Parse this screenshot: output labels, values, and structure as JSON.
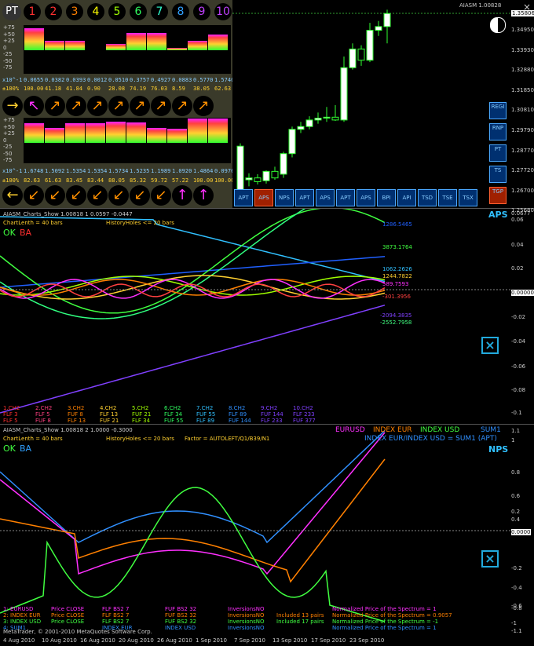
{
  "toolbar": {
    "pt_label": "PT",
    "numbers": [
      "1",
      "2",
      "3",
      "4",
      "5",
      "6",
      "7",
      "8",
      "9",
      "10"
    ],
    "number_colors": [
      "#ff3030",
      "#ff3030",
      "#ff8000",
      "#ffff00",
      "#a0ff00",
      "#30ff60",
      "#30ffd0",
      "#30a0ff",
      "#c040ff",
      "#c040ff"
    ]
  },
  "panel1": {
    "scale": [
      "+75",
      "+50",
      "+25",
      "0",
      "-25",
      "-50",
      "-75"
    ],
    "row_x10": [
      "x10^-1",
      "0.0655",
      "0.0382",
      "0.0393",
      "0.0012",
      "0.0510",
      "0.3757",
      "0.4927",
      "0.0883",
      "0.5770",
      "1.5740"
    ],
    "row_pct": [
      "±100%",
      "100.00",
      "41.18",
      "41.84",
      "0.90",
      "28.08",
      "74.19",
      "76.03",
      "8.59",
      "38.05",
      "62.63"
    ],
    "arrows": [
      "→",
      "↖",
      "↗",
      "↗",
      "↗",
      "↗",
      "↗",
      "↗",
      "↗",
      "↗"
    ]
  },
  "panel2": {
    "scale": [
      "+75",
      "+50",
      "+25",
      "0",
      "-25",
      "-50",
      "-75"
    ],
    "row_x10": [
      "x10^-1",
      "1.6748",
      "1.5092",
      "1.5354",
      "1.5354",
      "1.5734",
      "1.5235",
      "1.1989",
      "1.0920",
      "1.4864",
      "0.0976"
    ],
    "row_pct": [
      "±100%",
      "82.63",
      "61.63",
      "83.45",
      "83.44",
      "88.05",
      "85.32",
      "59.72",
      "57.22",
      "100.00",
      "100.00"
    ],
    "arrows": [
      "←",
      "↙",
      "↙",
      "↙",
      "↙",
      "↙",
      "↙",
      "↙",
      "↑",
      "↑"
    ]
  },
  "price_chart": {
    "title": "AIASM 1.00828",
    "current_price": "1.35806",
    "price_labels": [
      "1.34950",
      "1.33930",
      "1.32880",
      "1.31850",
      "1.30810",
      "1.29790",
      "1.28770",
      "1.27720",
      "1.26700",
      "1.25680"
    ],
    "side_buttons": [
      "REGI",
      "RNP",
      "PT",
      "TS",
      "TGP"
    ],
    "bottom_buttons": [
      "APT",
      "APS",
      "NPS",
      "APT",
      "APS",
      "APT",
      "APS",
      "BPI",
      "API",
      "TSD",
      "TSE",
      "TSX"
    ],
    "candles": [
      {
        "o": 1.258,
        "h": 1.2885,
        "l": 1.2565,
        "c": 1.287
      },
      {
        "o": 1.269,
        "h": 1.2725,
        "l": 1.2655,
        "c": 1.27
      },
      {
        "o": 1.27,
        "h": 1.272,
        "l": 1.2665,
        "c": 1.268
      },
      {
        "o": 1.2685,
        "h": 1.274,
        "l": 1.267,
        "c": 1.2735
      },
      {
        "o": 1.2735,
        "h": 1.276,
        "l": 1.269,
        "c": 1.27
      },
      {
        "o": 1.272,
        "h": 1.284,
        "l": 1.27,
        "c": 1.283
      },
      {
        "o": 1.283,
        "h": 1.2975,
        "l": 1.281,
        "c": 1.296
      },
      {
        "o": 1.296,
        "h": 1.3,
        "l": 1.294,
        "c": 1.2975
      },
      {
        "o": 1.2975,
        "h": 1.303,
        "l": 1.296,
        "c": 1.301
      },
      {
        "o": 1.301,
        "h": 1.305,
        "l": 1.299,
        "c": 1.302
      },
      {
        "o": 1.302,
        "h": 1.308,
        "l": 1.3,
        "c": 1.3025
      },
      {
        "o": 1.3025,
        "h": 1.309,
        "l": 1.3005,
        "c": 1.301
      },
      {
        "o": 1.301,
        "h": 1.335,
        "l": 1.3,
        "c": 1.329
      },
      {
        "o": 1.329,
        "h": 1.342,
        "l": 1.328,
        "c": 1.339
      },
      {
        "o": 1.339,
        "h": 1.341,
        "l": 1.33,
        "c": 1.333
      },
      {
        "o": 1.333,
        "h": 1.353,
        "l": 1.332,
        "c": 1.349
      },
      {
        "o": 1.349,
        "h": 1.354,
        "l": 1.346,
        "c": 1.351
      },
      {
        "o": 1.351,
        "h": 1.36,
        "l": 1.342,
        "c": 1.358
      }
    ]
  },
  "indicator1": {
    "title": "AIASM_Charts_Show 1.00818 1 0.0597 -0.0447",
    "chart_length": "ChartLenth = 40 bars",
    "history_holes": "HistoryHoles <= 20 bars",
    "tag": "APS",
    "ok": "OK",
    "ba": "BA",
    "axis": [
      "0.0677",
      "0.06",
      "0.04",
      "0.02",
      "0.00000",
      "-0.02",
      "-0.04",
      "-0.06",
      "-0.08",
      "-0.1"
    ],
    "value_labels": [
      {
        "text": "1286.5465",
        "color": "#2060ff"
      },
      {
        "text": "3873.1764",
        "color": "#40ff40"
      },
      {
        "text": "1062.2626",
        "color": "#30c0ff"
      },
      {
        "text": "1244.7822",
        "color": "#ffd030"
      },
      {
        "text": "589.7593",
        "color": "#ff30ff"
      },
      {
        "text": "-301.3956",
        "color": "#ff4040"
      },
      {
        "text": "-2094.3835",
        "color": "#8040ff"
      },
      {
        "text": "-2552.7958",
        "color": "#40ff80"
      }
    ],
    "legend_cols": [
      [
        "1.CH2",
        "FLF  3",
        "FLF  5"
      ],
      [
        "2.CH2",
        "FLF  5",
        "FUF  8"
      ],
      [
        "3.CH2",
        "FUF  8",
        "FLF 13"
      ],
      [
        "4.CH2",
        "FLF 13",
        "FUF 21"
      ],
      [
        "5.CH2",
        "FUF 21",
        "FLF 34"
      ],
      [
        "6.CH2",
        "FLF 34",
        "FUF 55"
      ],
      [
        "7.CH2",
        "FUF 55",
        "FLF 89"
      ],
      [
        "8.CH2",
        "FLF 89",
        "FUF 144"
      ],
      [
        "9.CH2",
        "FUF 144",
        "FLF 233"
      ],
      [
        "10.CH2",
        "FLF 233",
        "FUF 377"
      ]
    ]
  },
  "indicator2": {
    "title": "AIASM_Charts_Show 1.00818 2 1.0000 -0.3000",
    "chart_length": "ChartLenth = 40 bars",
    "history_holes": "HistoryHoles <= 20 bars",
    "factor": "Factor = AUTOLEFT/Q1/B39/N1",
    "tag": "NPS",
    "ok": "OK",
    "ba": "BA",
    "header_a": "EURUSD",
    "header_b": "INDEX EUR",
    "header_c": "INDEX USD",
    "header_d": "SUM1",
    "header_e": "INDEX EUR/INDEX USD = SUM1 (APT)",
    "axis": [
      "1.1",
      "1",
      "0.8",
      "0.6",
      "0.4",
      "0.2",
      "0.0000",
      "-0.2",
      "-0.4",
      "-0.6",
      "-0.8",
      "-1",
      "-1.1"
    ],
    "legend_rows": [
      {
        "a": "1: EURUSD",
        "b": "Price CLOSE",
        "c": "FLF BS2 7",
        "d": "FUF BS2 32",
        "e": "InversionsNO",
        "f": "",
        "g": "Normalized Price of the Spectrum = 1",
        "color": "#ff30ff"
      },
      {
        "a": "2: INDEX EUR",
        "b": "Price CLOSE",
        "c": "FLF BS2 7",
        "d": "FUF BS2 32",
        "e": "InversionsNO",
        "f": "Included 13 pairs",
        "g": "Normalized Price of the Spectrum = 0.9057",
        "color": "#ff8000"
      },
      {
        "a": "3: INDEX USD",
        "b": "Price CLOSE",
        "c": "FLF BS2 7",
        "d": "FUF BS2 32",
        "e": "InversionsNO",
        "f": "Included 17 pairs",
        "g": "Normalized Price of the Spectrum = -1",
        "color": "#40ff40"
      },
      {
        "a": "4: SUM1",
        "b": "",
        "c": "INDEX EUR",
        "d": "INDEX USD",
        "e": "InversionsNO",
        "f": "",
        "g": "Normalized Price of the Spectrum = 1",
        "color": "#3090ff"
      }
    ],
    "copyright": "MetaTrader, © 2001-2010 MetaQuotes Software Corp."
  },
  "dates": [
    "4 Aug 2010",
    "10 Aug 2010",
    "16 Aug 2010",
    "20 Aug 2010",
    "26 Aug 2010",
    "1 Sep 2010",
    "7 Sep 2010",
    "13 Sep 2010",
    "17 Sep 2010",
    "23 Sep 2010"
  ],
  "close_icon": "×"
}
